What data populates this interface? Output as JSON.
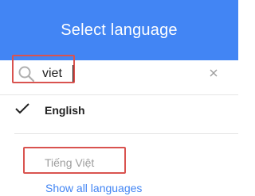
{
  "header": {
    "title": "Select language",
    "bg_color": "#4285f4"
  },
  "search": {
    "value": "viet",
    "search_icon": "search-icon",
    "clear_icon": "close-icon"
  },
  "languages": {
    "selected": {
      "label": "English",
      "icon": "check-icon"
    },
    "results": [
      {
        "label": "Tiếng Việt"
      }
    ],
    "show_all_label": "Show all languages"
  },
  "colors": {
    "accent": "#4285f4",
    "highlight": "#d9534f",
    "muted_text": "#9e9e9e"
  }
}
